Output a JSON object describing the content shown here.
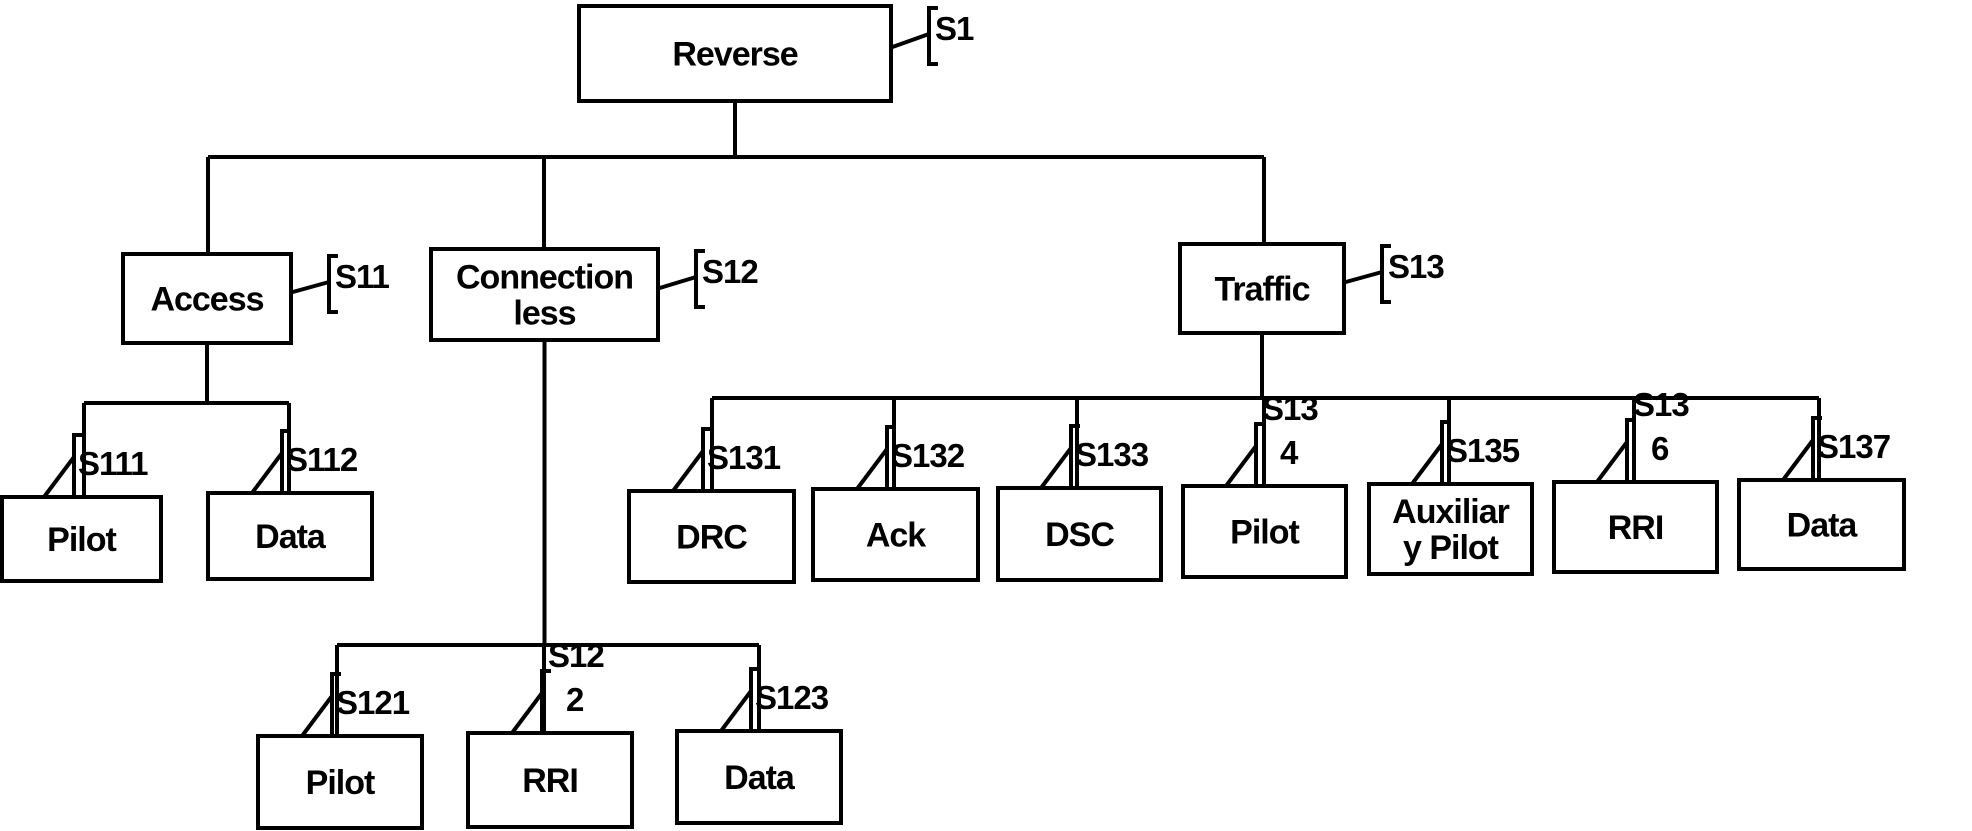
{
  "diagram": {
    "type": "tree",
    "root": {
      "id": "reverse",
      "lines": [
        "Reverse"
      ],
      "tag": [
        "S1"
      ],
      "children": [
        {
          "id": "access",
          "lines": [
            "Access"
          ],
          "tag": [
            "S11"
          ],
          "children": [
            {
              "id": "access-pilot",
              "lines": [
                "Pilot"
              ],
              "tag": [
                "S111"
              ]
            },
            {
              "id": "access-data",
              "lines": [
                "Data"
              ],
              "tag": [
                "S112"
              ]
            }
          ]
        },
        {
          "id": "connectionless",
          "lines": [
            "Connection",
            "less"
          ],
          "tag": [
            "S12"
          ],
          "children": [
            {
              "id": "cl-pilot",
              "lines": [
                "Pilot"
              ],
              "tag": [
                "S121"
              ]
            },
            {
              "id": "cl-rri",
              "lines": [
                "RRI"
              ],
              "tag": [
                "S12",
                "2"
              ]
            },
            {
              "id": "cl-data",
              "lines": [
                "Data"
              ],
              "tag": [
                "S123"
              ]
            }
          ]
        },
        {
          "id": "traffic",
          "lines": [
            "Traffic"
          ],
          "tag": [
            "S13"
          ],
          "children": [
            {
              "id": "tr-drc",
              "lines": [
                "DRC"
              ],
              "tag": [
                "S131"
              ]
            },
            {
              "id": "tr-ack",
              "lines": [
                "Ack"
              ],
              "tag": [
                "S132"
              ]
            },
            {
              "id": "tr-dsc",
              "lines": [
                "DSC"
              ],
              "tag": [
                "S133"
              ]
            },
            {
              "id": "tr-pilot",
              "lines": [
                "Pilot"
              ],
              "tag": [
                "S13",
                "4"
              ]
            },
            {
              "id": "tr-aux-pilot",
              "lines": [
                "Auxiliar",
                "y Pilot"
              ],
              "tag": [
                "S135"
              ]
            },
            {
              "id": "tr-rri",
              "lines": [
                "RRI"
              ],
              "tag": [
                "S13",
                "6"
              ]
            },
            {
              "id": "tr-data",
              "lines": [
                "Data"
              ],
              "tag": [
                "S137"
              ]
            }
          ]
        }
      ]
    }
  }
}
